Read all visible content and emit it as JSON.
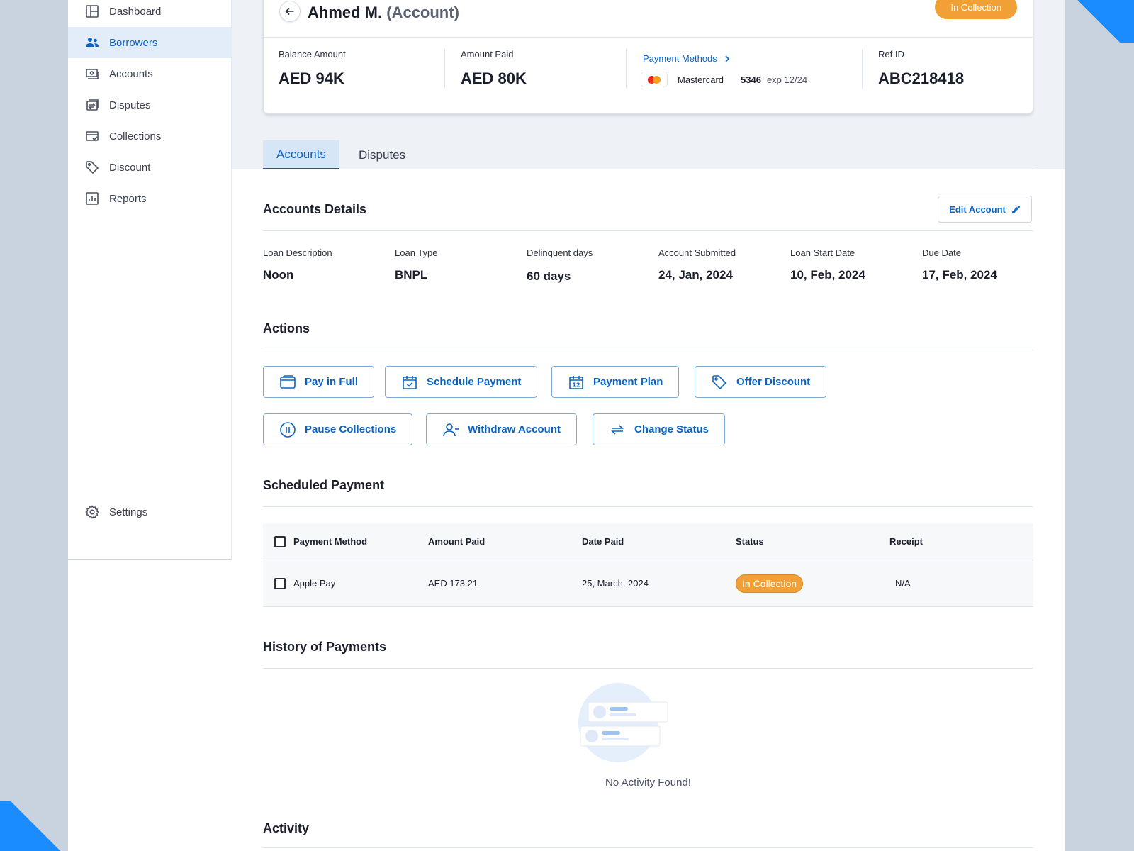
{
  "sidebar": {
    "items": [
      {
        "label": "Dashboard",
        "icon": "dashboard-icon"
      },
      {
        "label": "Borrowers",
        "icon": "users-icon"
      },
      {
        "label": "Accounts",
        "icon": "accounts-icon"
      },
      {
        "label": "Disputes",
        "icon": "disputes-icon"
      },
      {
        "label": "Collections",
        "icon": "collections-icon"
      },
      {
        "label": "Discount",
        "icon": "tag-icon"
      },
      {
        "label": "Reports",
        "icon": "reports-icon"
      }
    ],
    "settings_label": "Settings"
  },
  "header": {
    "name": "Ahmed M.",
    "sub": "(Account)",
    "status_badge": "In Collection"
  },
  "summary": {
    "balance_label": "Balance Amount",
    "balance_value": "AED 94K",
    "paid_label": "Amount Paid",
    "paid_value": "AED 80K",
    "payment_methods_label": "Payment Methods",
    "card_brand": "Mastercard",
    "card_last4": "5346",
    "card_exp": "exp 12/24",
    "ref_label": "Ref ID",
    "ref_value": "ABC218418"
  },
  "tabs": [
    {
      "label": "Accounts",
      "active": true
    },
    {
      "label": "Disputes",
      "active": false
    }
  ],
  "account_details": {
    "title": "Accounts Details",
    "edit_label": "Edit Account",
    "fields": [
      {
        "label": "Loan Description",
        "value": "Noon"
      },
      {
        "label": "Loan Type",
        "value": "BNPL"
      },
      {
        "label": "Delinquent days",
        "value": "60 days"
      },
      {
        "label": "Account Submitted",
        "value": "24, Jan, 2024"
      },
      {
        "label": "Loan Start Date",
        "value": "10, Feb, 2024"
      },
      {
        "label": "Due Date",
        "value": "17, Feb, 2024"
      }
    ]
  },
  "actions": {
    "title": "Actions",
    "buttons": [
      {
        "label": "Pay in Full",
        "icon": "wallet-icon"
      },
      {
        "label": "Schedule Payment",
        "icon": "calendar-check-icon"
      },
      {
        "label": "Payment Plan",
        "icon": "calendar-icon"
      },
      {
        "label": "Offer Discount",
        "icon": "tag-icon"
      },
      {
        "label": "Pause Collections",
        "icon": "pause-icon"
      },
      {
        "label": "Withdraw Account",
        "icon": "user-minus-icon"
      },
      {
        "label": "Change Status",
        "icon": "refresh-icon"
      }
    ]
  },
  "scheduled_payment": {
    "title": "Scheduled Payment",
    "columns": [
      "Payment Method",
      "Amount Paid",
      "Date Paid",
      "Status",
      "Receipt"
    ],
    "rows": [
      {
        "method": "Apple Pay",
        "amount": "AED 173.21",
        "date": "25, March, 2024",
        "status": "In Collection",
        "receipt": "N/A"
      }
    ]
  },
  "history": {
    "title": "History of Payments",
    "empty_text": "No Activity Found!"
  },
  "activity": {
    "title": "Activity"
  },
  "colors": {
    "accent": "#0a63c4",
    "status_orange": "#f0a035",
    "active_bg": "#e3edf9"
  }
}
